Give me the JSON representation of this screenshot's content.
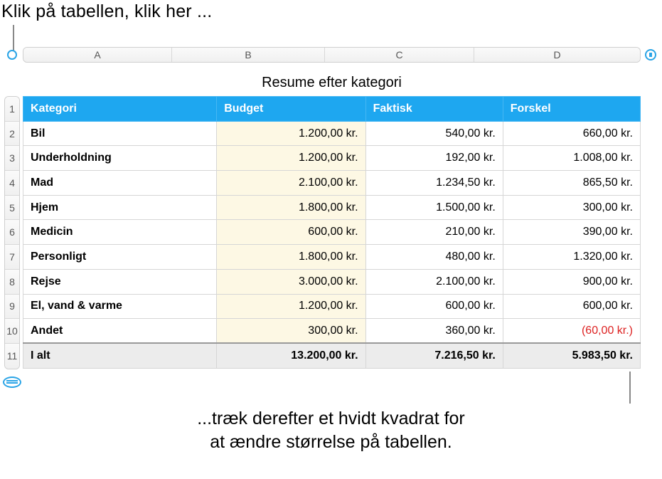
{
  "callouts": {
    "top": "Klik på tabellen, klik her ...",
    "bottom_line1": "...træk derefter et hvidt kvadrat for",
    "bottom_line2": "at ændre størrelse på tabellen."
  },
  "columns": {
    "a": "A",
    "b": "B",
    "c": "C",
    "d": "D"
  },
  "rownums": [
    "1",
    "2",
    "3",
    "4",
    "5",
    "6",
    "7",
    "8",
    "9",
    "10",
    "11"
  ],
  "title": "Resume efter kategori",
  "headers": {
    "kategori": "Kategori",
    "budget": "Budget",
    "faktisk": "Faktisk",
    "forskel": "Forskel"
  },
  "rows": [
    {
      "kategori": "Bil",
      "budget": "1.200,00 kr.",
      "faktisk": "540,00 kr.",
      "forskel": "660,00 kr."
    },
    {
      "kategori": "Underholdning",
      "budget": "1.200,00 kr.",
      "faktisk": "192,00 kr.",
      "forskel": "1.008,00 kr."
    },
    {
      "kategori": "Mad",
      "budget": "2.100,00 kr.",
      "faktisk": "1.234,50 kr.",
      "forskel": "865,50 kr."
    },
    {
      "kategori": "Hjem",
      "budget": "1.800,00 kr.",
      "faktisk": "1.500,00 kr.",
      "forskel": "300,00 kr."
    },
    {
      "kategori": "Medicin",
      "budget": "600,00 kr.",
      "faktisk": "210,00 kr.",
      "forskel": "390,00 kr."
    },
    {
      "kategori": "Personligt",
      "budget": "1.800,00 kr.",
      "faktisk": "480,00 kr.",
      "forskel": "1.320,00 kr."
    },
    {
      "kategori": "Rejse",
      "budget": "3.000,00 kr.",
      "faktisk": "2.100,00 kr.",
      "forskel": "900,00 kr."
    },
    {
      "kategori": "El, vand & varme",
      "budget": "1.200,00 kr.",
      "faktisk": "600,00 kr.",
      "forskel": "600,00 kr."
    },
    {
      "kategori": "Andet",
      "budget": "300,00 kr.",
      "faktisk": "360,00 kr.",
      "forskel": "(60,00 kr.)",
      "neg": true
    }
  ],
  "total": {
    "label": "I alt",
    "budget": "13.200,00 kr.",
    "faktisk": "7.216,50 kr.",
    "forskel": "5.983,50 kr."
  }
}
